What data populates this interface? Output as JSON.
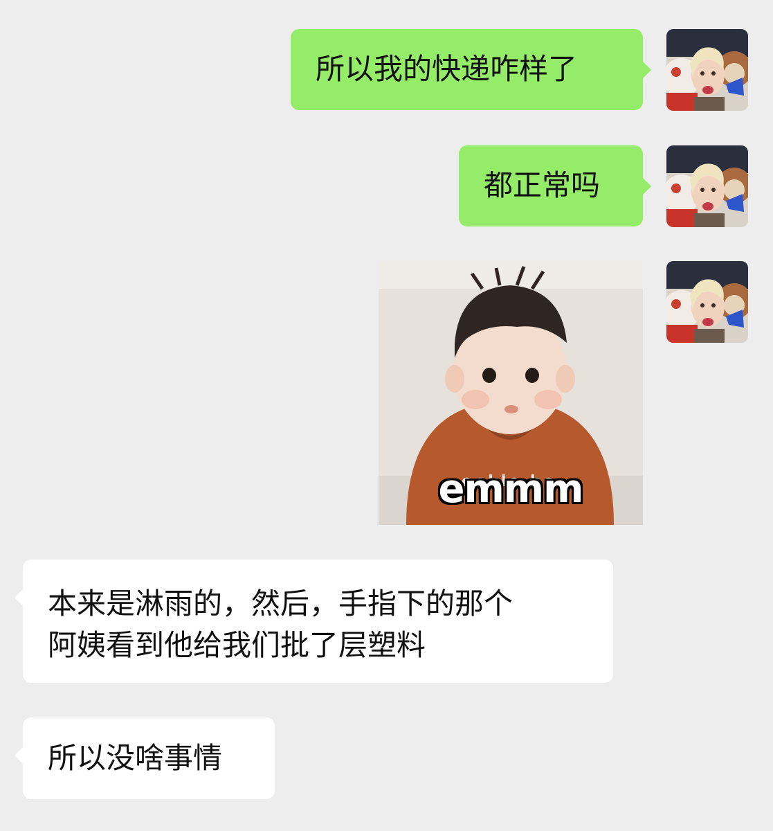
{
  "messages": [
    {
      "side": "out",
      "type": "text",
      "text": "所以我的快递咋样了"
    },
    {
      "side": "out",
      "type": "text",
      "text": "都正常吗"
    },
    {
      "side": "out",
      "type": "sticker",
      "icon": "baby-sticker",
      "caption": "emmm"
    },
    {
      "side": "in",
      "type": "text",
      "lines": [
        "本来是淋雨的，然后，手指下的那个",
        "阿姨看到他给我们批了层塑料"
      ]
    },
    {
      "side": "in",
      "type": "text",
      "text": "所以没啥事情"
    }
  ],
  "colors": {
    "background": "#ededed",
    "outgoing_bubble": "#95ec69",
    "incoming_bubble": "#ffffff",
    "text": "#111111"
  },
  "avatar_icon": "user-avatar-photo-icon"
}
